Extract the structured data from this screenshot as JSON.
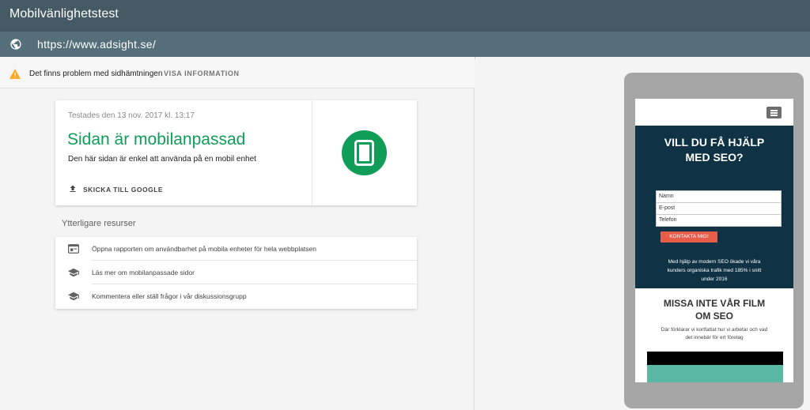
{
  "app": {
    "title": "Mobilvänlighetstest"
  },
  "urlbar": {
    "url": "https://www.adsight.se/"
  },
  "warning": {
    "text": "Det finns problem med sidhämtningen",
    "link": "VISA INFORMATION"
  },
  "result": {
    "tested": "Testades den 13 nov. 2017 kl. 13:17",
    "headline": "Sidan är mobilanpassad",
    "description": "Den här sidan är enkel att använda på en mobil enhet",
    "submit_label": "SKICKA TILL GOOGLE"
  },
  "resources": {
    "title": "Ytterligare resurser",
    "items": [
      {
        "label": "Öppna rapporten om användbarhet på mobila enheter för hela webbplatsen",
        "icon": "report-icon"
      },
      {
        "label": "Läs mer om mobilanpassade sidor",
        "icon": "school-icon"
      },
      {
        "label": "Kommentera eller ställ frågor i vår diskussionsgrupp",
        "icon": "school-icon"
      }
    ]
  },
  "preview": {
    "hero_title_1": "VILL DU FÅ HJÄLP",
    "hero_title_2": "MED SEO?",
    "fields": [
      "Namn",
      "E-post",
      "Telefon"
    ],
    "cta": "KONTAKTA MIG!",
    "hero_text_1": "Med hjälp av modern SEO ökade vi våra",
    "hero_text_2": "kunders organiska trafik med 185% i snitt",
    "hero_text_3": "under 2016",
    "film_title_1": "MISSA INTE VÅR FILM",
    "film_title_2": "OM SEO",
    "film_text_1": "Där förklarar vi kortfattat hur vi arbetar och vad",
    "film_text_2": "det innebär för ert företag"
  },
  "colors": {
    "appbar": "#455a64",
    "urlbar": "#546e7a",
    "success": "#0f9d58",
    "warning": "#f9a825",
    "hero": "#0f3344",
    "cta": "#e85d4a"
  }
}
